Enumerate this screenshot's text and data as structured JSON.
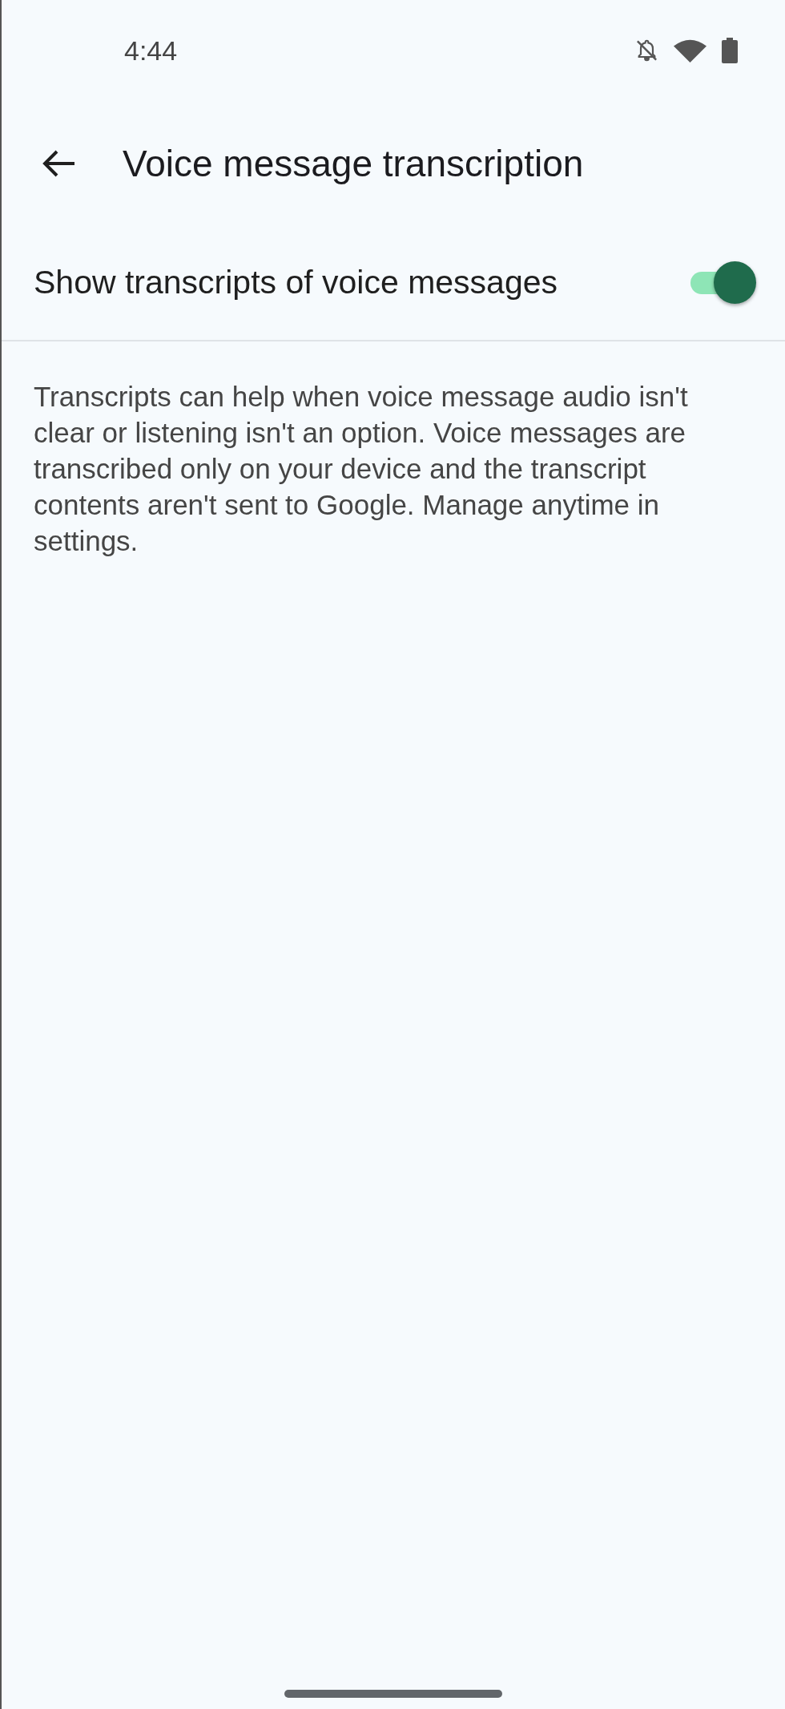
{
  "status_bar": {
    "time": "4:44"
  },
  "app_bar": {
    "title": "Voice message transcription"
  },
  "settings": [
    {
      "kind": "switch",
      "label": "Show transcripts of voice messages",
      "on": true
    }
  ],
  "description": "Transcripts can help when voice message audio isn't clear or listening isn't an option. Voice messages are transcribed only on your device and the transcript contents aren't sent to Google. Manage anytime in settings."
}
